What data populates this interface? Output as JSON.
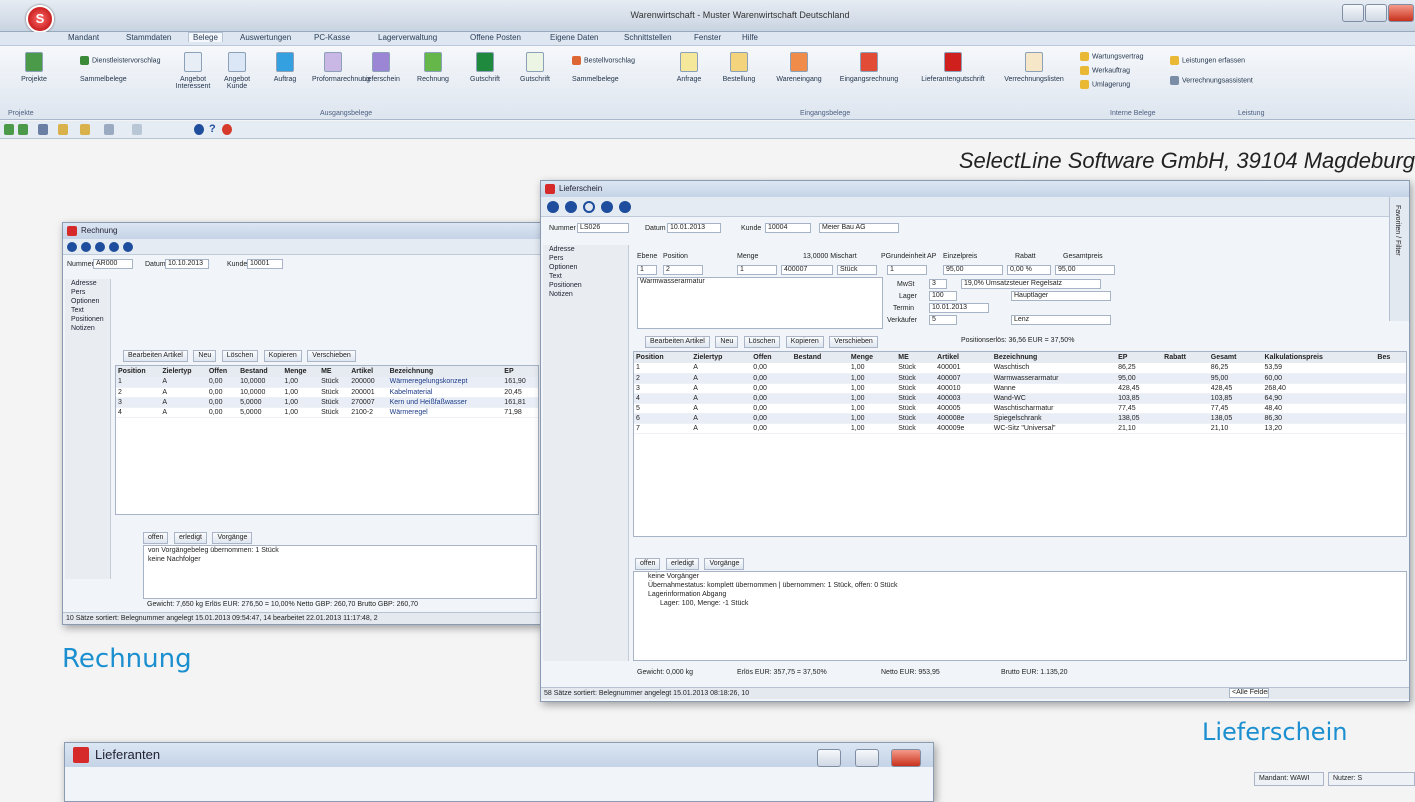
{
  "app": {
    "title": "Warenwirtschaft - Muster Warenwirtschaft Deutschland",
    "brand": "SelectLine Software GmbH, 39104 Magdeburg",
    "accent": "#1b8fcf"
  },
  "menu": [
    "Mandant",
    "Stammdaten",
    "Belege",
    "Auswertungen",
    "PC-Kasse",
    "Lagerverwaltung",
    "Offene Posten",
    "Eigene Daten",
    "Schnittstellen",
    "Fenster",
    "Hilfe"
  ],
  "ribbon": {
    "buttons": [
      "Projekte",
      "Sammelbelege",
      "Angebot Interessent",
      "Angebot Kunde",
      "Auftrag",
      "Proformarechnung",
      "Lieferschein",
      "Rechnung",
      "Gutschrift",
      "Gutschrift",
      "Sammelbelege",
      "Anfrage",
      "Bestellung",
      "Wareneingang",
      "Eingangsrechnung",
      "Lieferantengutschrift",
      "Verrechnungslisten",
      "Leistungen erfassen",
      "Verrechnungsassistent"
    ],
    "small": [
      "Dienstleistervorschlag",
      "Bestellvorschlag",
      "Wartungsvertrag",
      "Werkauftrag",
      "Umlagerung"
    ],
    "groups": [
      "Projekte",
      "Ausgangsbelege",
      "Eingangsbelege",
      "Interne Belege",
      "Leistung"
    ]
  },
  "rechnung_window": {
    "title": "Rechnung",
    "nummer_label": "Nummer",
    "nummer": "AR000",
    "datum_label": "Datum",
    "datum": "10.10.2013",
    "kunde_label": "Kunde",
    "kunde": "10001",
    "sidebar": [
      "Adresse",
      "Pers",
      "Optionen",
      "Text",
      "Positionen",
      "Notizen"
    ],
    "headers": [
      "Position",
      "Zielertyp",
      "Offen",
      "Bestand",
      "Menge",
      "ME",
      "Artikel",
      "Bezeichnung",
      "EP"
    ],
    "rows": [
      [
        "1",
        "A",
        "0,00",
        "10,0000",
        "1,00",
        "Stück",
        "200000",
        "Wärmeregelungskonzept",
        "161,90"
      ],
      [
        "2",
        "A",
        "0,00",
        "10,0000",
        "1,00",
        "Stück",
        "200001",
        "Kabelmaterial",
        "20,45"
      ],
      [
        "3",
        "A",
        "0,00",
        "5,0000",
        "1,00",
        "Stück",
        "270007",
        "Kern und Heißfaßwasser",
        "161,81"
      ],
      [
        "4",
        "A",
        "0,00",
        "5,0000",
        "1,00",
        "Stück",
        "2100-2",
        "Wärmeregel",
        "71,98"
      ]
    ],
    "buttons": [
      "Bearbeiten Artikel",
      "Neu",
      "Löschen",
      "Kopieren",
      "Verschieben"
    ],
    "tabs": [
      "offen",
      "erledigt",
      "Vorgänge"
    ],
    "tree": [
      "von Vorgängebeleg übernommen: 1 Stück",
      "keine Nachfolger"
    ],
    "footer": "Gewicht: 7,650 kg     Erlös EUR: 276,50 = 10,00%     Netto GBP: 260,70     Brutto GBP: 260,70",
    "status": "10 Sätze  sortiert: Belegnummer  angelegt 15.01.2013 09:54:47, 14  bearbeitet 22.01.2013 11:17:48, 2",
    "caption": "Rechnung"
  },
  "lieferschein_window": {
    "title": "Lieferschein",
    "nummer_label": "Nummer",
    "nummer": "LS026",
    "datum_label": "Datum",
    "datum": "10.01.2013",
    "kunde_label": "Kunde",
    "kunde": "10004",
    "kunde_name": "Meier Bau AG",
    "sidebar": [
      "Adresse",
      "Pers",
      "Optionen",
      "Text",
      "Positionen",
      "Notizen"
    ],
    "line_labels": [
      "Ebene",
      "Position",
      "Menge",
      "13,0000 Mischart",
      "PGrundeinheit",
      "AP",
      "Einzelpreis",
      "Rabatt",
      "Gesamtpreis"
    ],
    "line_values": [
      "1",
      "2",
      "1",
      "400007",
      "Stück",
      "1",
      "95,00",
      "0,00 %",
      "95,00"
    ],
    "article_text": "Warmwasserarmatur",
    "mwst_label": "MwSt",
    "mwst": "3",
    "mwst_text": "19,0% Umsatzsteuer Regelsatz",
    "lager_label": "Lager",
    "lager": "100",
    "lager_text": "Hauptlager",
    "termin_label": "Termin",
    "termin": "10.01.2013",
    "vertreter_label": "Verkäufer",
    "vertreter": "5",
    "vertreter_text": "Lenz",
    "buttons": [
      "Bearbeiten Artikel",
      "Neu",
      "Löschen",
      "Kopieren",
      "Verschieben"
    ],
    "pos_info": "Positionserlös: 36,56 EUR = 37,50%",
    "headers": [
      "Position",
      "Zielertyp",
      "Offen",
      "Bestand",
      "Menge",
      "ME",
      "Artikel",
      "Bezeichnung",
      "EP",
      "Rabatt",
      "Gesamt",
      "Kalkulationspreis",
      "Bes"
    ],
    "rows": [
      [
        "1",
        "A",
        "0,00",
        "",
        "1,00",
        "Stück",
        "400001",
        "Waschtisch",
        "86,25",
        "",
        "86,25",
        "53,59"
      ],
      [
        "2",
        "A",
        "0,00",
        "",
        "1,00",
        "Stück",
        "400007",
        "Warmwasserarmatur",
        "95,00",
        "",
        "95,00",
        "60,00"
      ],
      [
        "3",
        "A",
        "0,00",
        "",
        "1,00",
        "Stück",
        "400010",
        "Wanne",
        "428,45",
        "",
        "428,45",
        "268,40"
      ],
      [
        "4",
        "A",
        "0,00",
        "",
        "1,00",
        "Stück",
        "400003",
        "Wand-WC",
        "103,85",
        "",
        "103,85",
        "64,90"
      ],
      [
        "5",
        "A",
        "0,00",
        "",
        "1,00",
        "Stück",
        "400005",
        "Waschtischarmatur",
        "77,45",
        "",
        "77,45",
        "48,40"
      ],
      [
        "6",
        "A",
        "0,00",
        "",
        "1,00",
        "Stück",
        "400008e",
        "Spiegelschrank",
        "138,05",
        "",
        "138,05",
        "86,30"
      ],
      [
        "7",
        "A",
        "0,00",
        "",
        "1,00",
        "Stück",
        "400009e",
        "WC-Sitz \"Universal\"",
        "21,10",
        "",
        "21,10",
        "13,20"
      ]
    ],
    "tabs": [
      "offen",
      "erledigt",
      "Vorgänge"
    ],
    "tree": [
      "keine Vorgänger",
      "Übernahmestatus: komplett übernommen | übernommen: 1 Stück, offen: 0 Stück",
      "Lagerinformation Abgang",
      "Lager: 100, Menge: -1 Stück"
    ],
    "footer_gewicht": "Gewicht: 0,000 kg",
    "footer_erloes": "Erlös EUR: 357,75 = 37,50%",
    "footer_netto": "Netto EUR: 953,95",
    "footer_brutto": "Brutto EUR: 1.135,20",
    "status": "58 Sätze  sortiert: Belegnummer  angelegt 15.01.2013 08:18:26, 10",
    "filter": "<Alle Felder>",
    "sidebar_vertical": "Favoriten / Filter",
    "caption": "Lieferschein"
  },
  "lieferanten_window": {
    "title": "Lieferanten"
  },
  "bottom_status": {
    "mandant": "Mandant: WAWI",
    "nutzer": "Nutzer: S"
  }
}
